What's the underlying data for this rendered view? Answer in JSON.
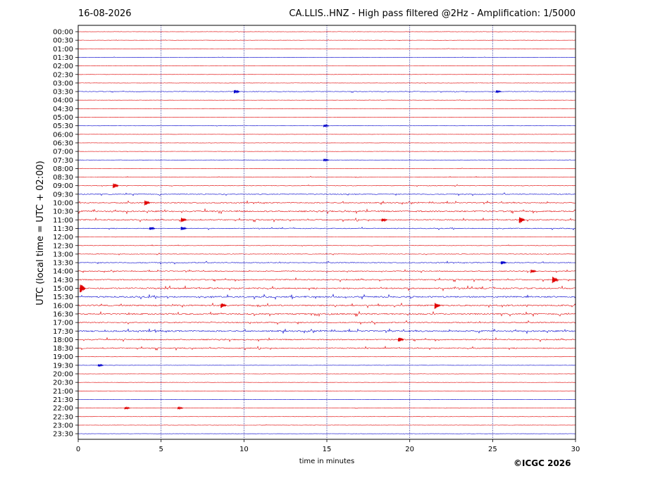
{
  "header": {
    "date": "16-08-2026",
    "title": "CA.LLIS..HNZ - High pass filtered @2Hz - Amplification: 1/5000"
  },
  "footer": {
    "copyright": "©ICGC 2026"
  },
  "colors": {
    "red": "#e00000",
    "blue": "#0000cc",
    "grid": "#000080"
  },
  "chart_data": {
    "type": "line",
    "subtype": "helicorder",
    "xlabel": "time in minutes",
    "ylabel": "UTC (local time = UTC + 02:00)",
    "xlim": [
      0,
      30
    ],
    "x_ticks": [
      0,
      5,
      10,
      15,
      20,
      25,
      30
    ],
    "x_tick_labels": [
      "0",
      "5",
      "10",
      "15",
      "20",
      "25",
      "30"
    ],
    "vertical_grid_minutes": [
      5,
      10,
      15,
      20,
      25
    ],
    "row_labels": [
      "00:00",
      "00:30",
      "01:00",
      "01:30",
      "02:00",
      "02:30",
      "03:00",
      "03:30",
      "04:00",
      "04:30",
      "05:00",
      "05:30",
      "06:00",
      "06:30",
      "07:00",
      "07:30",
      "08:00",
      "08:30",
      "09:00",
      "09:30",
      "10:00",
      "10:30",
      "11:00",
      "11:30",
      "12:00",
      "12:30",
      "13:00",
      "13:30",
      "14:00",
      "14:30",
      "15:00",
      "15:30",
      "16:00",
      "16:30",
      "17:00",
      "17:30",
      "18:00",
      "18:30",
      "19:00",
      "19:30",
      "20:00",
      "20:30",
      "21:00",
      "21:30",
      "22:00",
      "22:30",
      "23:00",
      "23:30"
    ],
    "trace_colors_cycle": [
      "red",
      "red",
      "red",
      "blue"
    ],
    "trace_noise_level": [
      1,
      1,
      1,
      1,
      1,
      1,
      1,
      2,
      1,
      1,
      1,
      1,
      1,
      1,
      1,
      1,
      1,
      2,
      2,
      3,
      4,
      5,
      4,
      3,
      1,
      2,
      2,
      3,
      3,
      4,
      5,
      5,
      5,
      5,
      4,
      5,
      4,
      4,
      1,
      1,
      1,
      1,
      1,
      1,
      1,
      1,
      1,
      1
    ],
    "events": [
      {
        "row": 7,
        "minute": 9.4,
        "amp": 3
      },
      {
        "row": 7,
        "minute": 25.2,
        "amp": 2
      },
      {
        "row": 11,
        "minute": 14.8,
        "amp": 2
      },
      {
        "row": 15,
        "minute": 14.8,
        "amp": 2
      },
      {
        "row": 18,
        "minute": 2.1,
        "amp": 4
      },
      {
        "row": 20,
        "minute": 4.0,
        "amp": 4
      },
      {
        "row": 22,
        "minute": 6.2,
        "amp": 4
      },
      {
        "row": 22,
        "minute": 18.3,
        "amp": 3
      },
      {
        "row": 22,
        "minute": 26.6,
        "amp": 6
      },
      {
        "row": 23,
        "minute": 4.3,
        "amp": 3
      },
      {
        "row": 23,
        "minute": 6.2,
        "amp": 3
      },
      {
        "row": 27,
        "minute": 25.5,
        "amp": 3
      },
      {
        "row": 28,
        "minute": 27.3,
        "amp": 3
      },
      {
        "row": 29,
        "minute": 28.6,
        "amp": 5
      },
      {
        "row": 30,
        "minute": 0.1,
        "amp": 8
      },
      {
        "row": 32,
        "minute": 8.6,
        "amp": 4
      },
      {
        "row": 32,
        "minute": 21.5,
        "amp": 5
      },
      {
        "row": 36,
        "minute": 19.3,
        "amp": 4
      },
      {
        "row": 39,
        "minute": 1.2,
        "amp": 2
      },
      {
        "row": 44,
        "minute": 2.8,
        "amp": 2
      },
      {
        "row": 44,
        "minute": 6.0,
        "amp": 2
      }
    ]
  }
}
